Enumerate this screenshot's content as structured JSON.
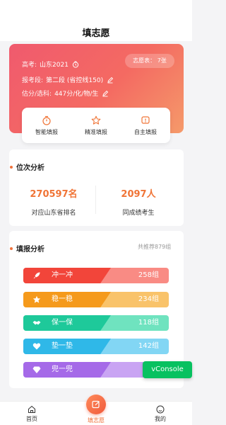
{
  "nav": {
    "title": "填志愿"
  },
  "hero": {
    "badge": "志愿表： 7张",
    "exam_label": "高考:",
    "exam_value": "山东2021",
    "stage_label": "报考段:",
    "stage_value": "第二段 (省控线150)",
    "score_label": "估分/选科:",
    "score_value": "447分/化/物/生"
  },
  "modes": [
    {
      "label": "智能填报",
      "icon": "smart-fill-icon"
    },
    {
      "label": "精准填报",
      "icon": "star-icon"
    },
    {
      "label": "自主填报",
      "icon": "self-fill-icon"
    }
  ],
  "rank": {
    "title": "位次分析",
    "rank_value": "270597名",
    "rank_label": "对应山东省排名",
    "same_value": "2097人",
    "same_label": "同成绩考生"
  },
  "fill": {
    "title": "填报分析",
    "recommended": "共推荐879组",
    "items": [
      {
        "name": "冲一冲",
        "count": "258组",
        "icon": "rocket-icon",
        "color_left": "#f2453a",
        "color_right": "#f98b84"
      },
      {
        "name": "稳一稳",
        "count": "234组",
        "icon": "star-icon",
        "color_left": "#f59a1c",
        "color_right": "#f9c36a"
      },
      {
        "name": "保一保",
        "count": "118组",
        "icon": "handshake-icon",
        "color_left": "#1ec99a",
        "color_right": "#6fe3bf"
      },
      {
        "name": "垫一垫",
        "count": "142组",
        "icon": "heart-icon",
        "color_left": "#2fb8e8",
        "color_right": "#82d6f4"
      },
      {
        "name": "兜一兜",
        "count": "1",
        "icon": "diamond-icon",
        "color_left": "#a56ae8",
        "color_right": "#c9a4f3"
      }
    ]
  },
  "vconsole": "vConsole",
  "tabbar": {
    "home": "首页",
    "fill": "填志愿",
    "mine": "我的"
  }
}
